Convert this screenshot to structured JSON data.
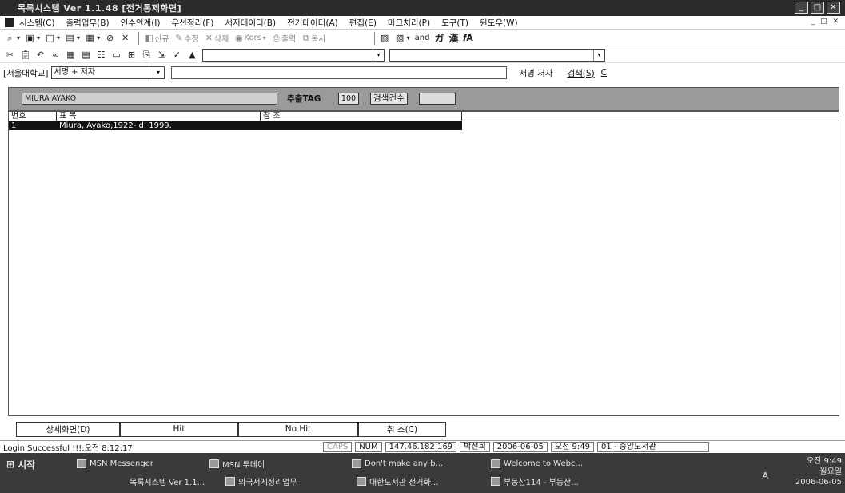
{
  "window": {
    "title": "목록시스템 Ver 1.1.48  [전거통제화면]",
    "controls": [
      "_",
      "□",
      "✕"
    ]
  },
  "menu": {
    "items": [
      "시스템(C)",
      "출력업무(B)",
      "인수인계(I)",
      "우선정리(F)",
      "서지데이터(B)",
      "전거데이터(A)",
      "편집(E)",
      "마크처리(P)",
      "도구(T)",
      "윈도우(W)"
    ],
    "mdi_controls": "_ □ ✕"
  },
  "toolbar1": {
    "new_label": "신규",
    "edit_label": "수정",
    "delete_label": "삭제",
    "kor_label": "Kors",
    "print_label": "출력",
    "copy_label": "복사",
    "format_items": [
      "and",
      "ガ",
      "漢",
      "𝒇A"
    ]
  },
  "searchbar": {
    "library": "[서울대학교]",
    "field_select": "서명 + 저자",
    "query_value": "",
    "hint": "서명 저자",
    "search_button": "검색(S)",
    "clear_button": "C"
  },
  "query_panel": {
    "query_text": "MIURA AYAKO",
    "tag_label": "추출TAG",
    "tag_value": "100",
    "count_label": "검색건수",
    "count_value": ""
  },
  "results": {
    "columns": [
      "번호",
      "표  목",
      "참  조"
    ],
    "rows": [
      {
        "no": "1",
        "heading": "Miura, Ayako,1922-  d. 1999.",
        "ref": ""
      }
    ]
  },
  "buttons": {
    "detail": "상세화면(D)",
    "hit": "Hit",
    "no_hit": "No Hit",
    "cancel": "취    소(C)"
  },
  "status": {
    "message": "Login Successful !!!:오전 8:12:17",
    "caps": "CAPS",
    "num": "NUM",
    "ip": "147.46.182.169",
    "user": "박선희",
    "date": "2006-06-05",
    "time": "오전 9:49",
    "branch": "01 - 중앙도서관"
  },
  "taskbar": {
    "start": "시작",
    "tasks": [
      "MSN Messenger",
      "MSN 투데이",
      "Don't make any b...",
      "Welcome to Webc...",
      "목록시스템 Ver 1.1...",
      "외국서게정리업무",
      "대한도서관 전거화...",
      "부동산114 - 부동산..."
    ],
    "ime": "A",
    "clock_time": "오전 9:49",
    "clock_day": "월요일",
    "clock_date": "2006-06-05"
  }
}
